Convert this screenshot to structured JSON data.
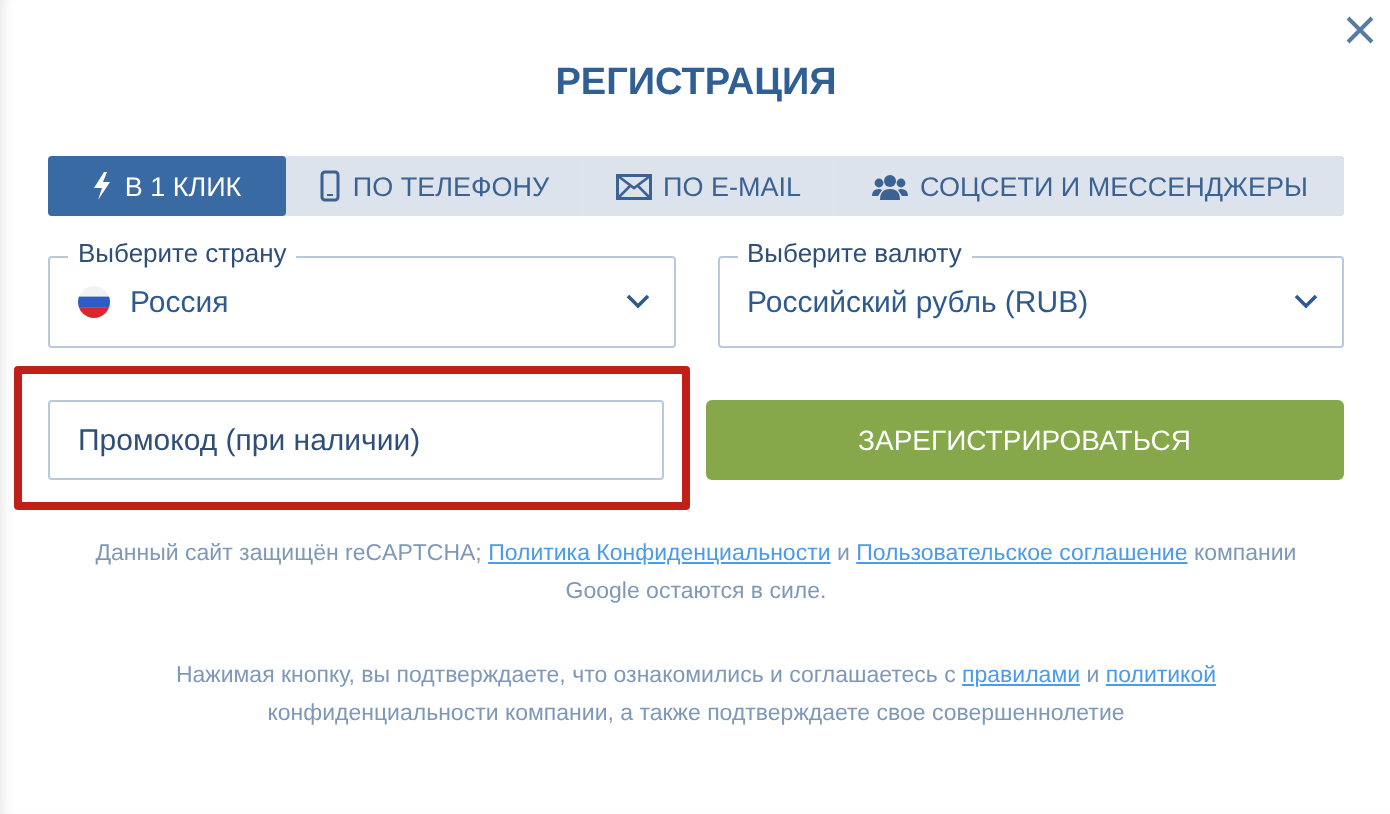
{
  "title": "РЕГИСТРАЦИЯ",
  "tabs": [
    {
      "label": "В 1 КЛИК",
      "kind": "bolt",
      "selected": true
    },
    {
      "label": "ПО ТЕЛЕФОНУ",
      "kind": "phone",
      "selected": false
    },
    {
      "label": "ПО E-MAIL",
      "kind": "mail",
      "selected": false
    },
    {
      "label": "СОЦСЕТИ И МЕССЕНДЖЕРЫ",
      "kind": "people",
      "selected": false
    }
  ],
  "selects": [
    {
      "label": "Выберите страну",
      "value": "Россия",
      "flag": true
    },
    {
      "label": "Выберите валюту",
      "value": "Российский рубль (RUB)",
      "flag": false
    }
  ],
  "promo": {
    "placeholder": "Промокод (при наличии)",
    "highlighted": true
  },
  "submit": "ЗАРЕГИСТРИРОВАТЬСЯ",
  "notes": [
    [
      {
        "kind": "text",
        "text": "Данный сайт защищён reCAPTCHA; "
      },
      {
        "kind": "link",
        "text": "Политика Конфиденциальности"
      },
      {
        "kind": "text",
        "text": " и "
      },
      {
        "kind": "link",
        "text": "Пользовательское соглашение"
      },
      {
        "kind": "text",
        "text": " компании Google остаются в силе."
      }
    ],
    [
      {
        "kind": "text",
        "text": "Нажимая кнопку, вы подтверждаете, что ознакомились и соглашаетесь с "
      },
      {
        "kind": "link",
        "text": "правилами"
      },
      {
        "kind": "text",
        "text": " и "
      },
      {
        "kind": "link",
        "text": "политикой"
      },
      {
        "kind": "text",
        "text": " конфиденциальности компании, а также подтверждаете свое совершеннолетие"
      }
    ]
  ]
}
